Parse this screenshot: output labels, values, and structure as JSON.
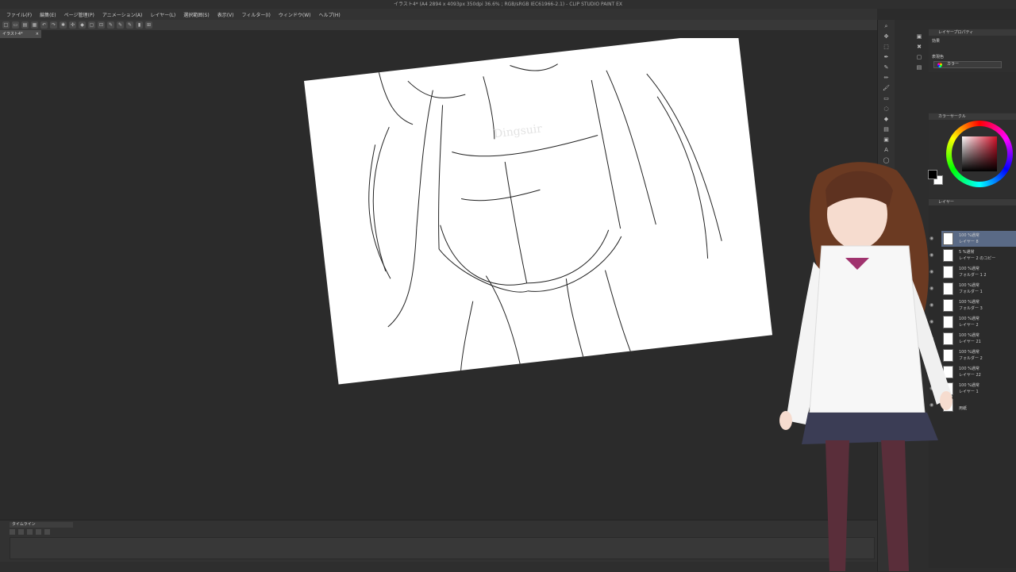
{
  "window": {
    "title": "イラスト4* (A4 2894 x 4093px 350dpi 36.6% ; RGB/sRGB IEC61966-2.1) - CLIP STUDIO PAINT EX"
  },
  "menu": [
    "ファイル(F)",
    "編集(E)",
    "ページ管理(P)",
    "アニメーション(A)",
    "レイヤー(L)",
    "選択範囲(S)",
    "表示(V)",
    "フィルター(I)",
    "ウィンドウ(W)",
    "ヘルプ(H)"
  ],
  "document_tab": {
    "label": "イラスト4*",
    "close": "×"
  },
  "canvas": {
    "watermark": "Dingsuir"
  },
  "timeline": {
    "label": "タイムライン"
  },
  "tool_property": {
    "header": "レイヤープロパティ",
    "effect_label": "効果",
    "expression_label": "表現色",
    "expression_value": "カラー"
  },
  "color_panel": {
    "header": "カラーサークル",
    "fg": "#000000",
    "bg": "#ffffff",
    "accent": "#d4112a"
  },
  "layer_panel": {
    "header": "レイヤー",
    "layers": [
      {
        "pct": "100 %通常",
        "name": "レイヤー 8",
        "selected": true
      },
      {
        "pct": "5 %通常",
        "name": "レイヤー 2 のコピー",
        "selected": false
      },
      {
        "pct": "100 %通常",
        "name": "フォルダー 1 2",
        "selected": false
      },
      {
        "pct": "100 %通常",
        "name": "フォルダー 1",
        "selected": false
      },
      {
        "pct": "100 %通常",
        "name": "フォルダー 3",
        "selected": false
      },
      {
        "pct": "100 %通常",
        "name": "レイヤー 2",
        "selected": false
      },
      {
        "pct": "100 %通常",
        "name": "レイヤー 21",
        "selected": false
      },
      {
        "pct": "100 %通常",
        "name": "フォルダー 2",
        "selected": false
      },
      {
        "pct": "100 %通常",
        "name": "レイヤー 22",
        "selected": false
      },
      {
        "pct": "100 %通常",
        "name": "レイヤー 1",
        "selected": false
      },
      {
        "pct": "",
        "name": "用紙",
        "selected": false
      }
    ]
  }
}
